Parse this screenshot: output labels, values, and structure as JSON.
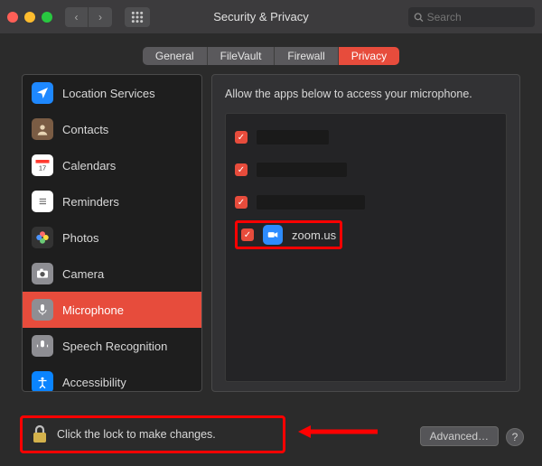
{
  "window": {
    "title": "Security & Privacy",
    "search_placeholder": "Search"
  },
  "tabs": [
    {
      "label": "General",
      "active": false
    },
    {
      "label": "FileVault",
      "active": false
    },
    {
      "label": "Firewall",
      "active": false
    },
    {
      "label": "Privacy",
      "active": true
    }
  ],
  "sidebar": {
    "items": [
      {
        "label": "Location Services",
        "icon": "location-icon",
        "bg": "#1e88ff"
      },
      {
        "label": "Contacts",
        "icon": "contacts-icon",
        "bg": "#7a5c44"
      },
      {
        "label": "Calendars",
        "icon": "calendar-icon",
        "bg": "#ffffff"
      },
      {
        "label": "Reminders",
        "icon": "reminders-icon",
        "bg": "#ffffff"
      },
      {
        "label": "Photos",
        "icon": "photos-icon",
        "bg": "#333333"
      },
      {
        "label": "Camera",
        "icon": "camera-icon",
        "bg": "#8e8e93"
      },
      {
        "label": "Microphone",
        "icon": "microphone-icon",
        "bg": "#8e8e93",
        "active": true
      },
      {
        "label": "Speech Recognition",
        "icon": "speech-icon",
        "bg": "#8e8e93"
      },
      {
        "label": "Accessibility",
        "icon": "accessibility-icon",
        "bg": "#0a84ff"
      }
    ]
  },
  "main": {
    "description": "Allow the apps below to access your microphone.",
    "apps": [
      {
        "checked": true,
        "name": "",
        "redacted": true
      },
      {
        "checked": true,
        "name": "",
        "redacted": true
      },
      {
        "checked": true,
        "name": "",
        "redacted": true
      },
      {
        "checked": true,
        "name": "zoom.us",
        "redacted": false,
        "icon_bg": "#2d8cff",
        "highlighted": true
      }
    ]
  },
  "footer": {
    "lock_text": "Click the lock to make changes.",
    "advanced_label": "Advanced…",
    "help_label": "?"
  }
}
